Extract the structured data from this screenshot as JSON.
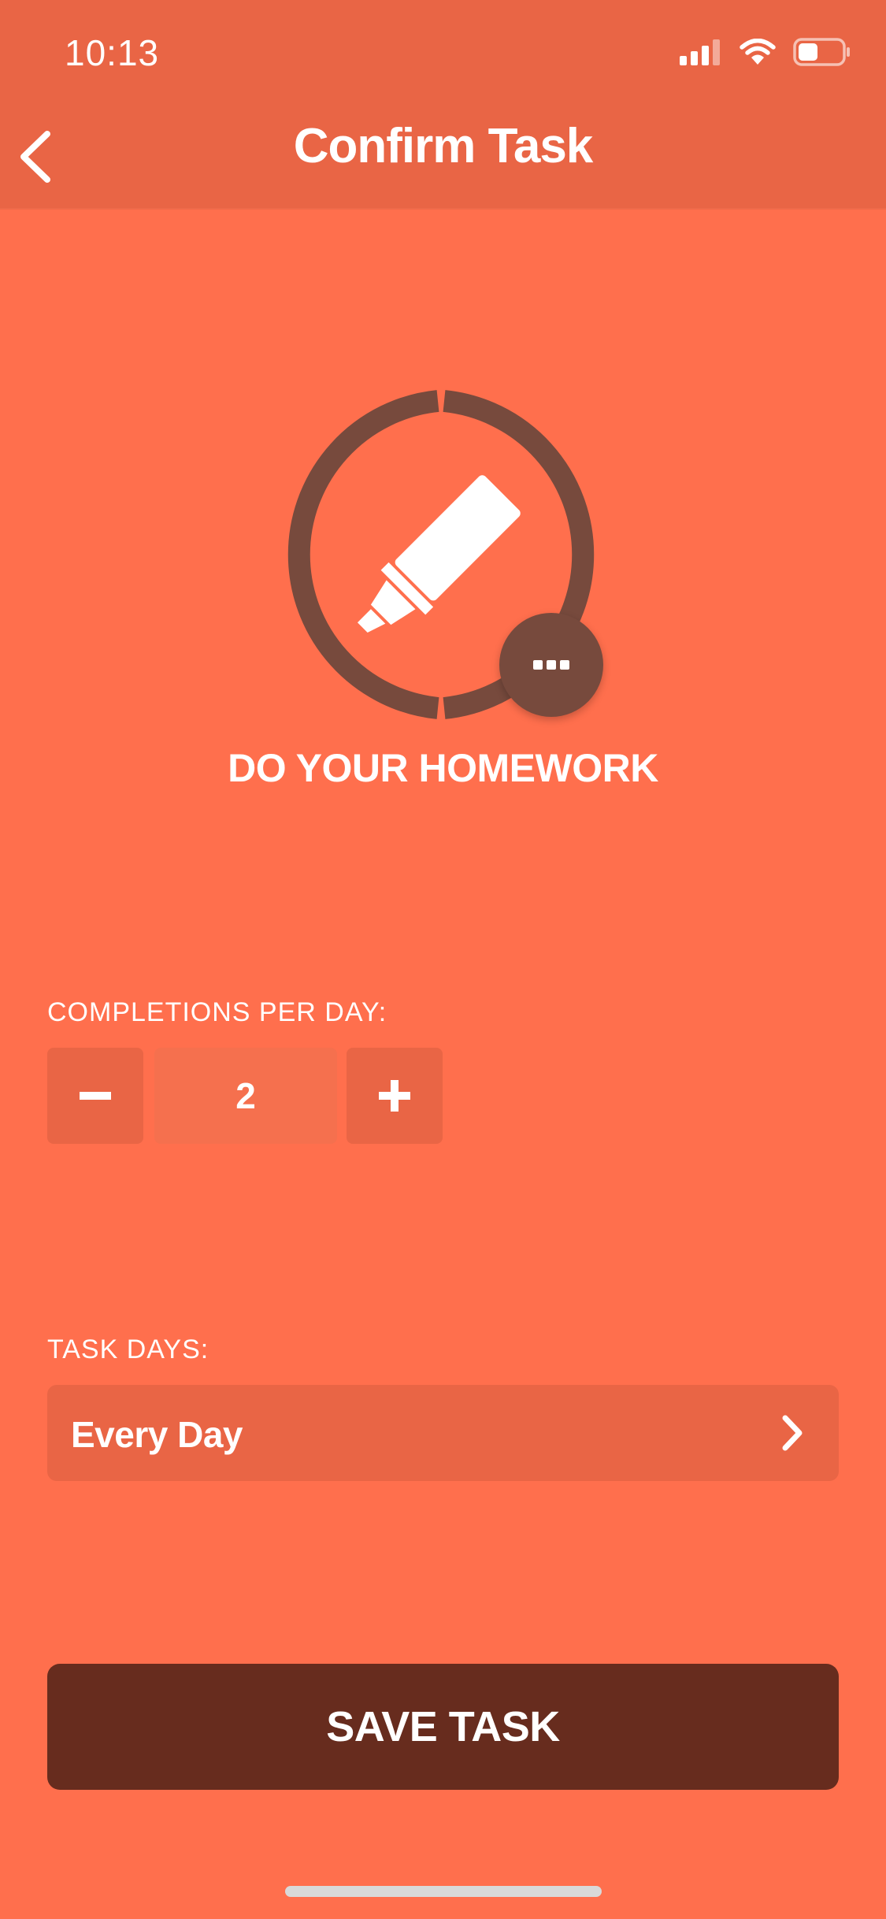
{
  "status_bar": {
    "time": "10:13",
    "icons": [
      "cellular-signal-icon",
      "wifi-icon",
      "battery-icon"
    ]
  },
  "nav": {
    "title": "Confirm Task",
    "back_icon": "chevron-left-icon"
  },
  "task": {
    "name": "DO YOUR HOMEWORK",
    "icon": "highlighter-icon",
    "more_icon": "ellipsis-icon"
  },
  "completions": {
    "label": "COMPLETIONS PER DAY:",
    "value": "2",
    "decrement_icon": "minus-icon",
    "increment_icon": "plus-icon"
  },
  "task_days": {
    "label": "TASK DAYS:",
    "value": "Every Day",
    "chevron_icon": "chevron-right-icon"
  },
  "save": {
    "label": "SAVE TASK"
  },
  "colors": {
    "background": "#FF6F4D",
    "header": "#E96545",
    "ring": "#774A3D",
    "save_button": "#672C1E",
    "text": "#FFFFFF"
  }
}
